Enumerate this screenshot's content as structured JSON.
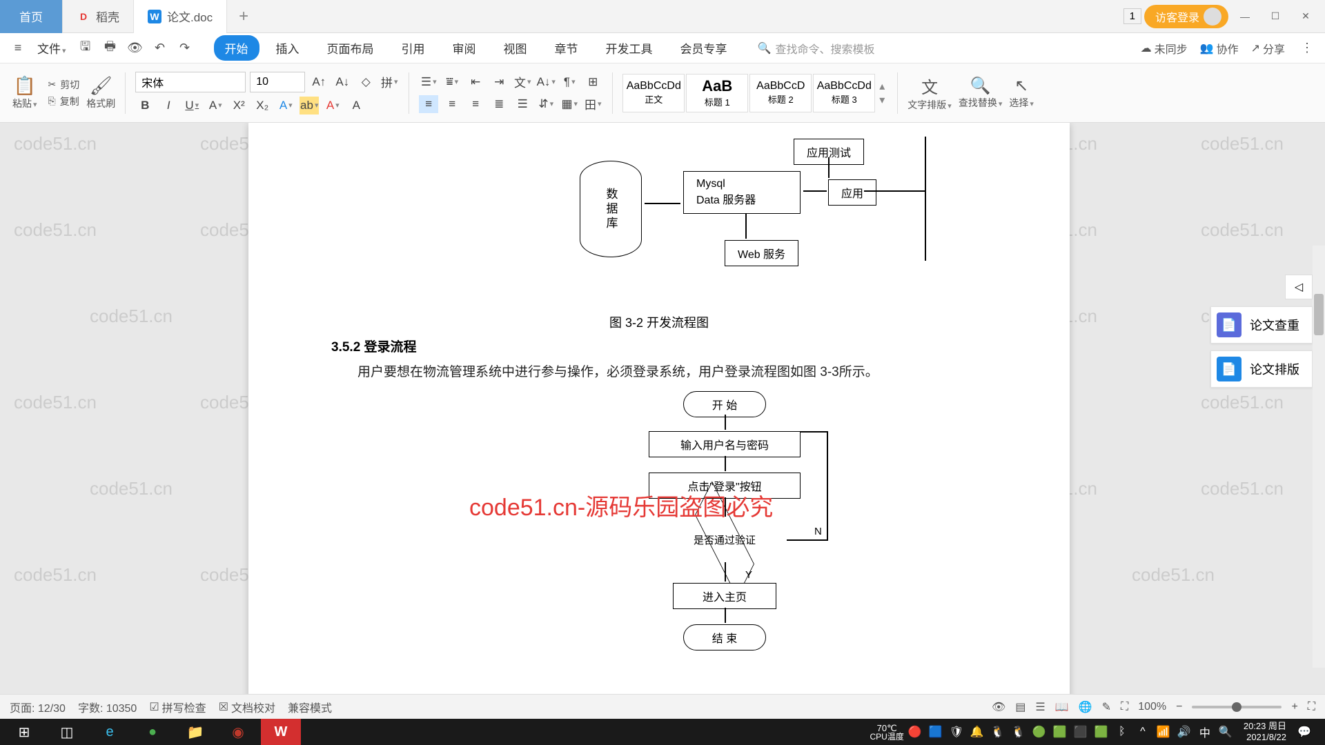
{
  "titlebar": {
    "tabs": [
      {
        "label": "首页"
      },
      {
        "label": "稻壳",
        "icon": "D",
        "iconColor": "#e53935"
      },
      {
        "label": "论文.doc",
        "icon": "W",
        "iconColor": "#1e88e5"
      }
    ],
    "badge": "1",
    "guest_login": "访客登录"
  },
  "menubar": {
    "file": "文件",
    "tabs": [
      "开始",
      "插入",
      "页面布局",
      "引用",
      "审阅",
      "视图",
      "章节",
      "开发工具",
      "会员专享"
    ],
    "active_tab": 0,
    "search_placeholder": "查找命令、搜索模板",
    "right": {
      "sync": "未同步",
      "collab": "协作",
      "share": "分享"
    }
  },
  "ribbon": {
    "paste": "粘贴",
    "cut": "剪切",
    "copy": "复制",
    "format_painter": "格式刷",
    "font": "宋体",
    "size": "10",
    "styles": [
      {
        "preview": "AaBbCcDd",
        "name": "正文"
      },
      {
        "preview": "AaB",
        "name": "标题 1"
      },
      {
        "preview": "AaBbCcD",
        "name": "标题 2"
      },
      {
        "preview": "AaBbCcDd",
        "name": "标题 3"
      }
    ],
    "text_layout": "文字排版",
    "find_replace": "查找替换",
    "select": "选择"
  },
  "document": {
    "diagram1": {
      "db": "数据库",
      "mysql": "Mysql\nData 服务器",
      "app_test": "应用测试",
      "app": "应用",
      "web": "Web 服务",
      "caption": "图 3-2  开发流程图"
    },
    "heading": "3.5.2 登录流程",
    "para": "用户要想在物流管理系统中进行参与操作，必须登录系统，用户登录流程图如图 3-3所示。",
    "flow": {
      "start": "开  始",
      "input": "输入用户名与密码",
      "click": "点击\"登录\"按钮",
      "check": "是否通过验证",
      "yes": "Y",
      "no": "N",
      "enter": "进入主页",
      "end": "结  束"
    },
    "watermark_red": "code51.cn-源码乐园盗图必究",
    "watermark_grey": "code51.cn"
  },
  "side_panel": {
    "item1": "论文查重",
    "item2": "论文排版"
  },
  "statusbar": {
    "page": "页面: 12/30",
    "words": "字数: 10350",
    "spell": "拼写检查",
    "proof": "文档校对",
    "compat": "兼容模式",
    "zoom": "100%"
  },
  "taskbar": {
    "cpu_label": "CPU温度",
    "temp": "70℃",
    "time": "20:23 周日",
    "date": "2021/8/22"
  }
}
